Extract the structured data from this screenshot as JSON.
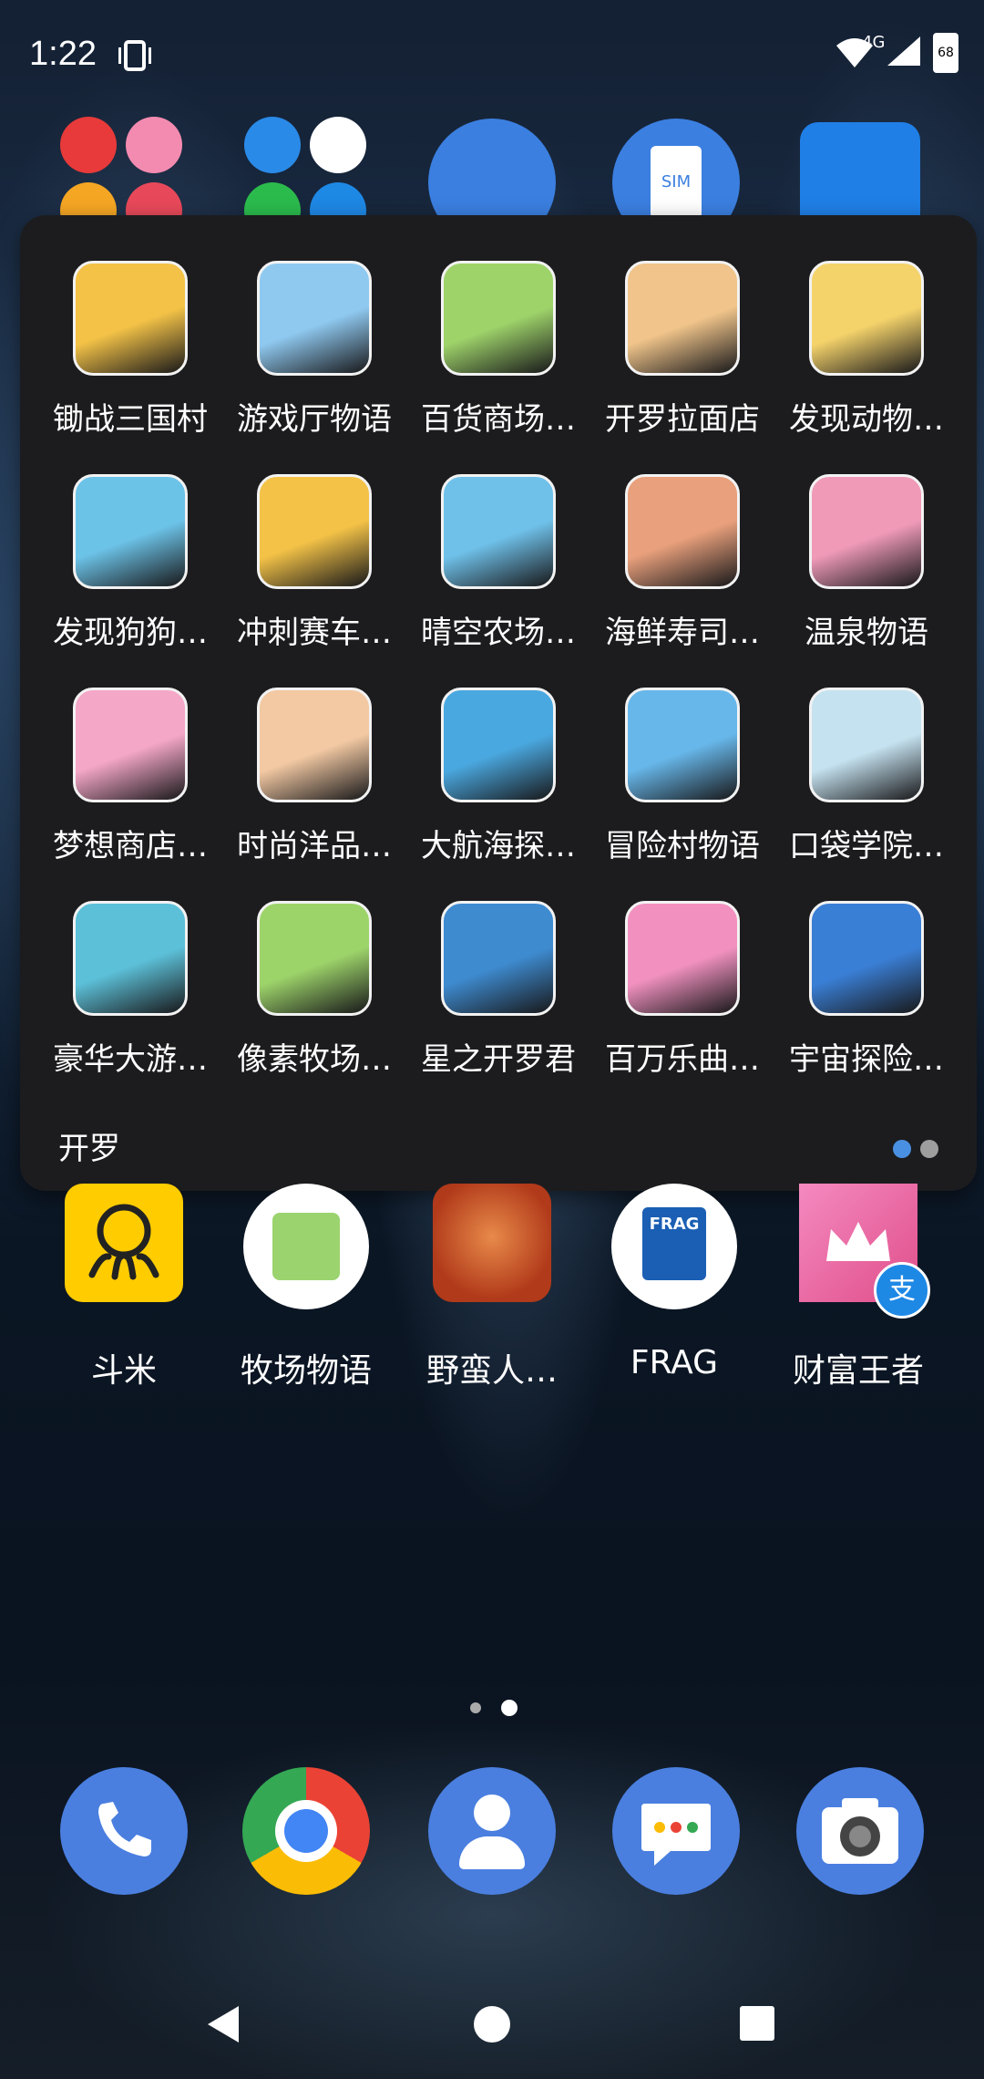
{
  "status_bar": {
    "time": "1:22",
    "network": "4G",
    "battery": "68"
  },
  "folder": {
    "name": "开罗",
    "apps": [
      {
        "label": "锄战三国村",
        "bg": "#f3c247"
      },
      {
        "label": "游戏厅物语",
        "bg": "#8fc9f0"
      },
      {
        "label": "百货商场…",
        "bg": "#9ed36a"
      },
      {
        "label": "开罗拉面店",
        "bg": "#f0c48a"
      },
      {
        "label": "发现动物…",
        "bg": "#f5d36b"
      },
      {
        "label": "发现狗狗…",
        "bg": "#6cc3e8"
      },
      {
        "label": "冲刺赛车…",
        "bg": "#f3c247"
      },
      {
        "label": "晴空农场…",
        "bg": "#6fc1ea"
      },
      {
        "label": "海鲜寿司…",
        "bg": "#e9a07c"
      },
      {
        "label": "温泉物语",
        "bg": "#f09ab8"
      },
      {
        "label": "梦想商店…",
        "bg": "#f5a7c8"
      },
      {
        "label": "时尚洋品…",
        "bg": "#f3c9a3"
      },
      {
        "label": "大航海探…",
        "bg": "#4aa8e0"
      },
      {
        "label": "冒险村物语",
        "bg": "#67b7ea"
      },
      {
        "label": "口袋学院…",
        "bg": "#c5e2f0"
      },
      {
        "label": "豪华大游…",
        "bg": "#5cc0d8"
      },
      {
        "label": "像素牧场…",
        "bg": "#9dd46a"
      },
      {
        "label": "星之开罗君",
        "bg": "#3e8bd0"
      },
      {
        "label": "百万乐曲…",
        "bg": "#f291c0"
      },
      {
        "label": "宇宙探险…",
        "bg": "#3a7fd6"
      }
    ],
    "page_dots": [
      {
        "color": "#4a90e2"
      },
      {
        "color": "#9e9e9e"
      }
    ]
  },
  "home_row": [
    {
      "label": "斗米",
      "icon": "octopus-icon"
    },
    {
      "label": "牧场物语",
      "icon": "cow-icon"
    },
    {
      "label": "野蛮人…",
      "icon": "barbarian-icon"
    },
    {
      "label": "FRAG",
      "icon": "frag-icon"
    },
    {
      "label": "财富王者",
      "icon": "crown-icon"
    }
  ],
  "top_row": {
    "sim_label": "SIM"
  },
  "frag_text": "FRAG",
  "alipay_badge": "支"
}
